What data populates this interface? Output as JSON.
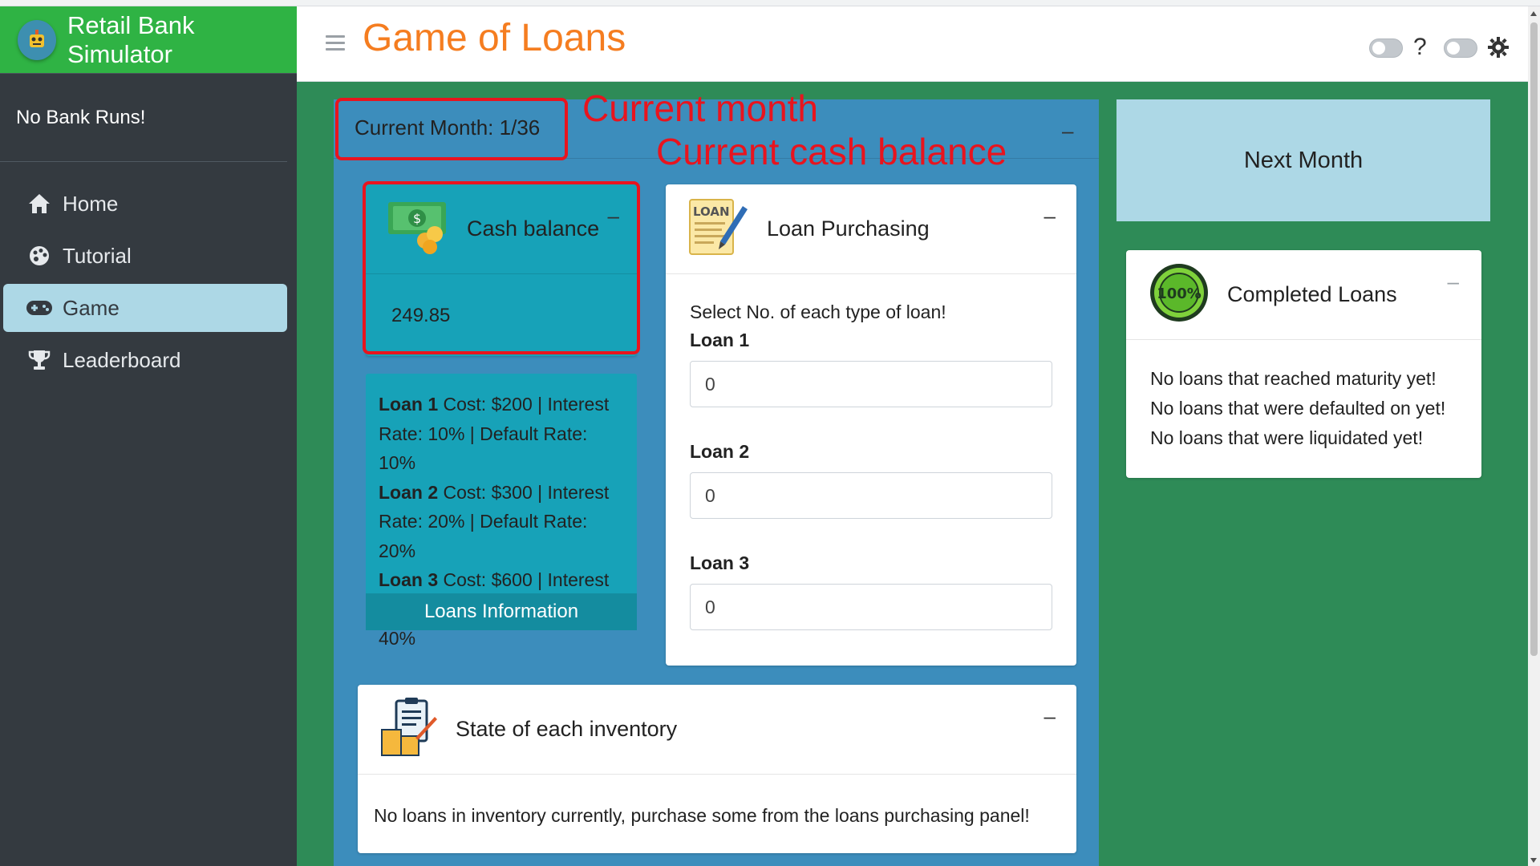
{
  "app": {
    "title": "Retail Bank Simulator"
  },
  "sidebar": {
    "user_status": "No Bank Runs!",
    "items": [
      {
        "label": "Home",
        "icon": "home-icon",
        "active": false
      },
      {
        "label": "Tutorial",
        "icon": "palette-icon",
        "active": false
      },
      {
        "label": "Game",
        "icon": "gamepad-icon",
        "active": true
      },
      {
        "label": "Leaderboard",
        "icon": "trophy-icon",
        "active": false
      }
    ]
  },
  "header": {
    "title": "Game of Loans",
    "help_label": "?"
  },
  "game": {
    "current_month": "Current Month: 1/36",
    "collapse_label": "–",
    "cash": {
      "title": "Cash balance",
      "value": "249.85"
    },
    "loans_info": {
      "lines": [
        {
          "name": "Loan 1",
          "text": " Cost: $200 | Interest Rate: 10% | Default Rate: 10%"
        },
        {
          "name": "Loan 2",
          "text": " Cost: $300 | Interest Rate: 20% | Default Rate: 20%"
        },
        {
          "name": "Loan 3",
          "text": " Cost: $600 | Interest Rate: 40% | Default Rate: 40%"
        }
      ],
      "footer": "Loans Information"
    },
    "purchasing": {
      "title": "Loan Purchasing",
      "instruction": "Select No. of each type of loan!",
      "fields": [
        {
          "label": "Loan 1",
          "value": "0"
        },
        {
          "label": "Loan 2",
          "value": "0"
        },
        {
          "label": "Loan 3",
          "value": "0"
        }
      ]
    },
    "inventory": {
      "title": "State of each inventory",
      "message": "No loans in inventory currently, purchase some from the loans purchasing panel!"
    }
  },
  "next_month_label": "Next Month",
  "completed": {
    "title": "Completed Loans",
    "badge": "100%",
    "messages": [
      "No loans that reached maturity yet!",
      "No loans that were defaulted on yet!",
      "No loans that were liquidated yet!"
    ]
  },
  "annotations": {
    "month_note": "Current month",
    "cash_note": "Current cash balance"
  },
  "colors": {
    "brand_green": "#2fb344",
    "main_green": "#2e8b57",
    "game_blue": "#3c8dbc",
    "cash_teal": "#17a2b8",
    "title_orange": "#f57d20",
    "active_nav": "#add8e6",
    "annotation_red": "#e8141e"
  }
}
